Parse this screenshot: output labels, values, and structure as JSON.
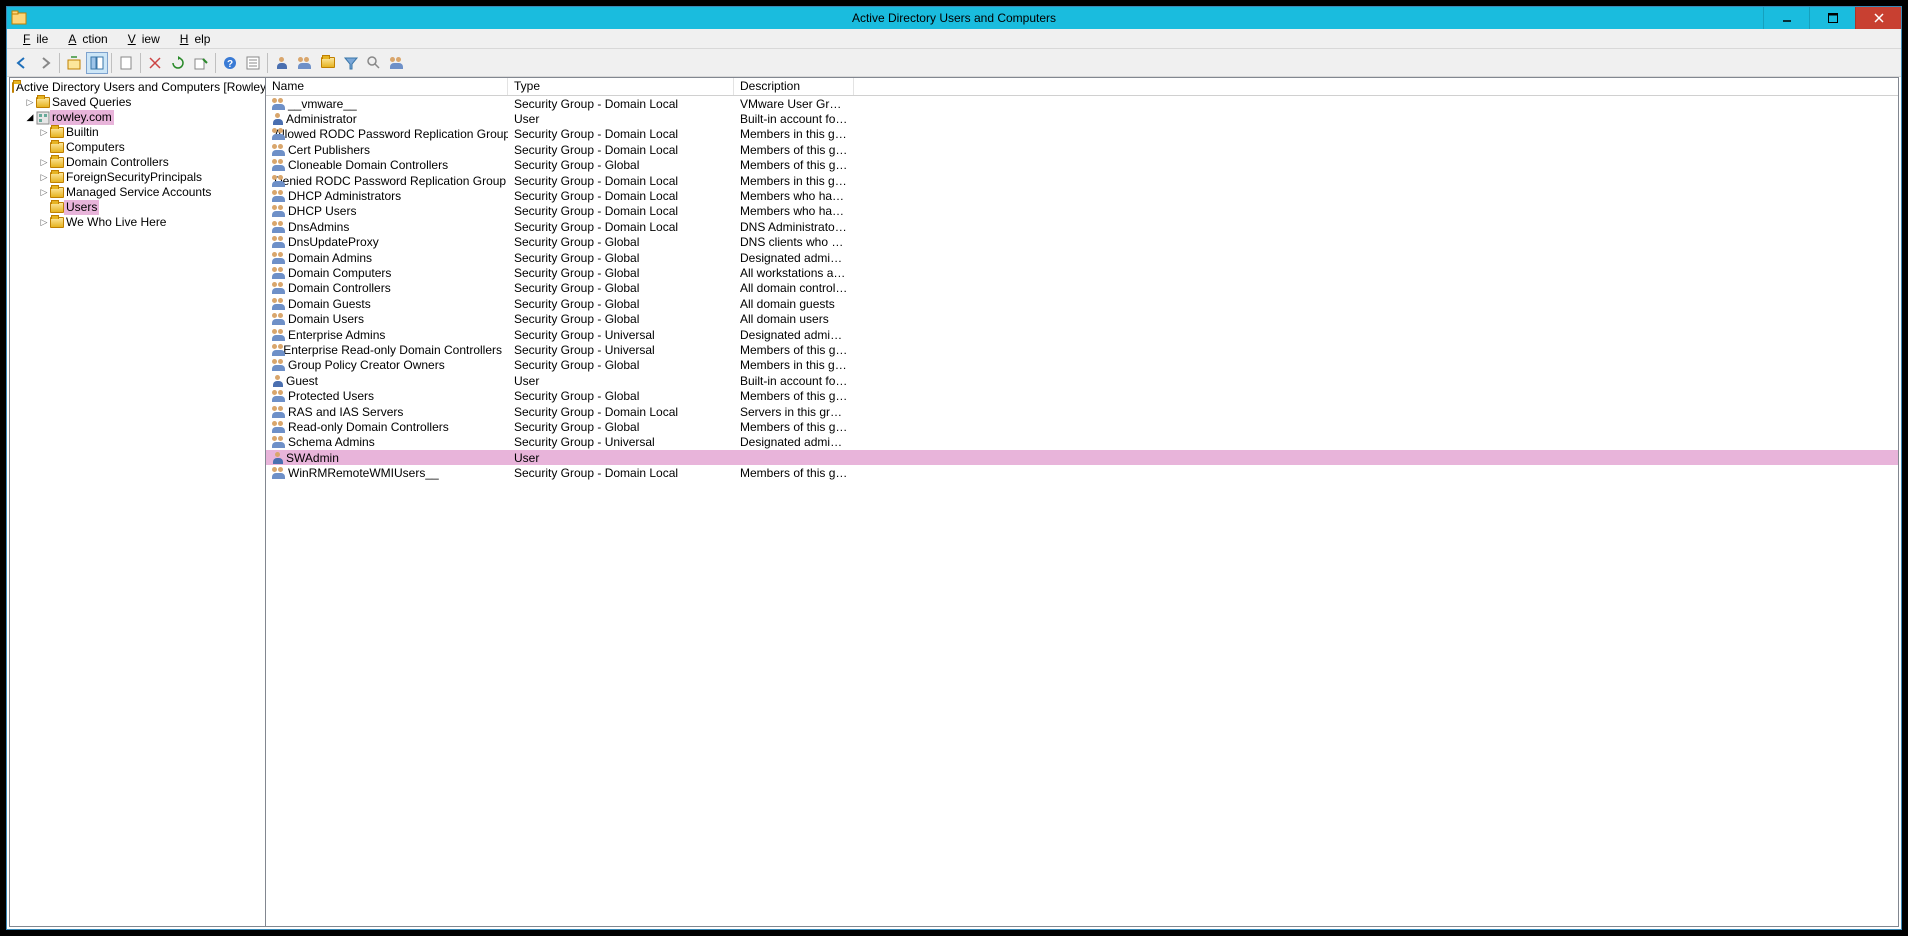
{
  "window": {
    "title": "Active Directory Users and Computers"
  },
  "menus": {
    "file": "File",
    "action": "Action",
    "view": "View",
    "help": "Help"
  },
  "tree": {
    "root": "Active Directory Users and Computers [RowleyServer.",
    "savedQueries": "Saved Queries",
    "domain": "rowley.com",
    "nodes": {
      "builtin": "Builtin",
      "computers": "Computers",
      "domainControllers": "Domain Controllers",
      "fsp": "ForeignSecurityPrincipals",
      "msa": "Managed Service Accounts",
      "users": "Users",
      "custom": "We Who Live Here"
    }
  },
  "columns": {
    "name": "Name",
    "type": "Type",
    "desc": "Description"
  },
  "rows": [
    {
      "icon": "group",
      "name": "__vmware__",
      "type": "Security Group - Domain Local",
      "desc": "VMware User Group",
      "sel": false
    },
    {
      "icon": "user",
      "name": "Administrator",
      "type": "User",
      "desc": "Built-in account for ad...",
      "sel": false
    },
    {
      "icon": "group",
      "name": "Allowed RODC Password Replication Group",
      "type": "Security Group - Domain Local",
      "desc": "Members in this group c...",
      "sel": false
    },
    {
      "icon": "group",
      "name": "Cert Publishers",
      "type": "Security Group - Domain Local",
      "desc": "Members of this group ...",
      "sel": false
    },
    {
      "icon": "group",
      "name": "Cloneable Domain Controllers",
      "type": "Security Group - Global",
      "desc": "Members of this group t...",
      "sel": false
    },
    {
      "icon": "group",
      "name": "Denied RODC Password Replication Group",
      "type": "Security Group - Domain Local",
      "desc": "Members in this group c...",
      "sel": false
    },
    {
      "icon": "group",
      "name": "DHCP Administrators",
      "type": "Security Group - Domain Local",
      "desc": "Members who have ad...",
      "sel": false
    },
    {
      "icon": "group",
      "name": "DHCP Users",
      "type": "Security Group - Domain Local",
      "desc": "Members who have vie...",
      "sel": false
    },
    {
      "icon": "group",
      "name": "DnsAdmins",
      "type": "Security Group - Domain Local",
      "desc": "DNS Administrators Gro...",
      "sel": false
    },
    {
      "icon": "group",
      "name": "DnsUpdateProxy",
      "type": "Security Group - Global",
      "desc": "DNS clients who are per...",
      "sel": false
    },
    {
      "icon": "group",
      "name": "Domain Admins",
      "type": "Security Group - Global",
      "desc": "Designated administrato...",
      "sel": false
    },
    {
      "icon": "group",
      "name": "Domain Computers",
      "type": "Security Group - Global",
      "desc": "All workstations and ser...",
      "sel": false
    },
    {
      "icon": "group",
      "name": "Domain Controllers",
      "type": "Security Group - Global",
      "desc": "All domain controllers i...",
      "sel": false
    },
    {
      "icon": "group",
      "name": "Domain Guests",
      "type": "Security Group - Global",
      "desc": "All domain guests",
      "sel": false
    },
    {
      "icon": "group",
      "name": "Domain Users",
      "type": "Security Group - Global",
      "desc": "All domain users",
      "sel": false
    },
    {
      "icon": "group",
      "name": "Enterprise Admins",
      "type": "Security Group - Universal",
      "desc": "Designated administrato...",
      "sel": false
    },
    {
      "icon": "group",
      "name": "Enterprise Read-only Domain Controllers",
      "type": "Security Group - Universal",
      "desc": "Members of this group ...",
      "sel": false
    },
    {
      "icon": "group",
      "name": "Group Policy Creator Owners",
      "type": "Security Group - Global",
      "desc": "Members in this group c...",
      "sel": false
    },
    {
      "icon": "user",
      "name": "Guest",
      "type": "User",
      "desc": "Built-in account for gue...",
      "sel": false
    },
    {
      "icon": "group",
      "name": "Protected Users",
      "type": "Security Group - Global",
      "desc": "Members of this group ...",
      "sel": false
    },
    {
      "icon": "group",
      "name": "RAS and IAS Servers",
      "type": "Security Group - Domain Local",
      "desc": "Servers in this group can...",
      "sel": false
    },
    {
      "icon": "group",
      "name": "Read-only Domain Controllers",
      "type": "Security Group - Global",
      "desc": "Members of this group ...",
      "sel": false
    },
    {
      "icon": "group",
      "name": "Schema Admins",
      "type": "Security Group - Universal",
      "desc": "Designated administrato...",
      "sel": false
    },
    {
      "icon": "user",
      "name": "SWAdmin",
      "type": "User",
      "desc": "",
      "sel": true
    },
    {
      "icon": "group",
      "name": "WinRMRemoteWMIUsers__",
      "type": "Security Group - Domain Local",
      "desc": "Members of this group ...",
      "sel": false
    }
  ]
}
